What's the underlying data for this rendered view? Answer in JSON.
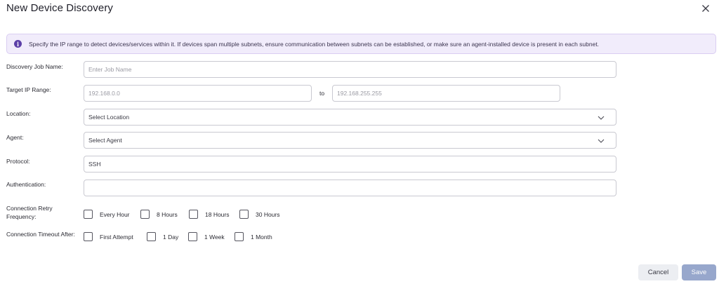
{
  "dialog": {
    "title": "New Device Discovery"
  },
  "banner": {
    "text": "Specify the IP range to detect devices/services within it. If devices span multiple subnets, ensure communication between subnets can be established, or make sure an agent-installed device is present in each subnet."
  },
  "fields": {
    "job_name": {
      "label": "Discovery Job Name:",
      "placeholder": "Enter Job Name"
    },
    "ip_range": {
      "label": "Target IP Range:",
      "from_placeholder": "192.168.0.0",
      "separator": "to",
      "to_placeholder": "192.168.255.255"
    },
    "location": {
      "label": "Location:",
      "value": "Select Location"
    },
    "agent": {
      "label": "Agent:",
      "value": "Select Agent"
    },
    "protocol": {
      "label": "Protocol:",
      "value": "SSH"
    },
    "authentication": {
      "label": "Authentication:",
      "value": ""
    },
    "retry_frequency": {
      "label_line1": "Connection Retry",
      "label_line2": "Frequency:",
      "options": [
        "Every Hour",
        "8 Hours",
        "18 Hours",
        "30 Hours"
      ]
    },
    "timeout_after": {
      "label": "Connection Timeout After:",
      "options": [
        "First Attempt",
        "1 Day",
        "1 Week",
        "1 Month"
      ]
    }
  },
  "actions": {
    "cancel_label": "Cancel",
    "save_label": "Save"
  },
  "colors": {
    "banner_bg": "#f1ecfb",
    "info_icon": "#5c3fa8",
    "save_bg": "#97a7cc",
    "cancel_bg": "#eceef2"
  },
  "icons": {
    "close": "close-icon",
    "info": "info-icon",
    "dropdown": "chevron-down-icon"
  }
}
